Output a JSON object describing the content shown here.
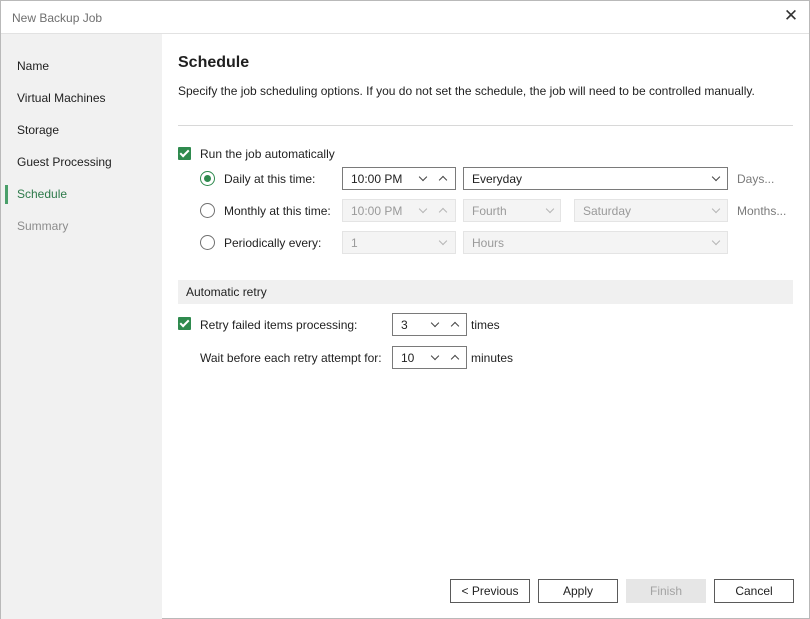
{
  "window": {
    "title": "New Backup Job",
    "close_glyph": "✕"
  },
  "sidebar": {
    "items": [
      {
        "label": "Name",
        "state": "normal"
      },
      {
        "label": "Virtual Machines",
        "state": "normal"
      },
      {
        "label": "Storage",
        "state": "normal"
      },
      {
        "label": "Guest Processing",
        "state": "normal"
      },
      {
        "label": "Schedule",
        "state": "active"
      },
      {
        "label": "Summary",
        "state": "disabled"
      }
    ]
  },
  "main": {
    "heading": "Schedule",
    "description": "Specify the job scheduling options. If you do not set the schedule, the job will need to be controlled manually.",
    "run_automatically": {
      "label": "Run the job automatically",
      "checked": true
    },
    "daily": {
      "label": "Daily at this time:",
      "selected": true,
      "time": "10:00 PM",
      "days": "Everyday",
      "link": "Days..."
    },
    "monthly": {
      "label": "Monthly at this time:",
      "selected": false,
      "time": "10:00 PM",
      "week": "Fourth",
      "day": "Saturday",
      "link": "Months..."
    },
    "periodically": {
      "label": "Periodically every:",
      "selected": false,
      "value": "1",
      "unit": "Hours"
    },
    "retry_section": {
      "title": "Automatic retry",
      "retry_failed": {
        "label": "Retry failed items processing:",
        "checked": true,
        "value": "3",
        "unit": "times"
      },
      "wait": {
        "label": "Wait before each retry attempt for:",
        "value": "10",
        "unit": "minutes"
      }
    }
  },
  "footer": {
    "previous": "< Previous",
    "apply": "Apply",
    "finish": "Finish",
    "cancel": "Cancel"
  },
  "colors": {
    "accent": "#2f8a4e",
    "sidebar_bg": "#f1f1f1"
  }
}
